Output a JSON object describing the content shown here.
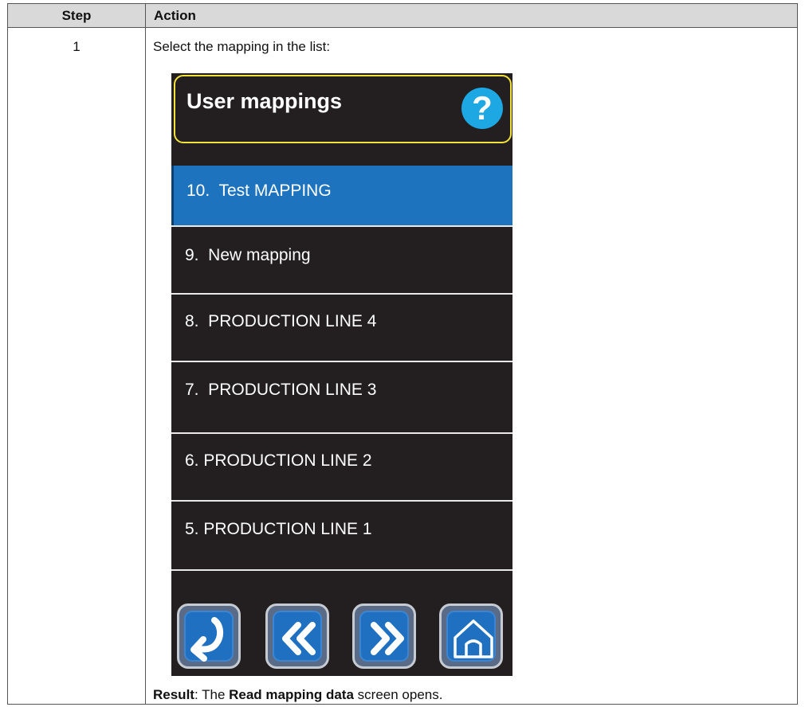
{
  "table": {
    "header": {
      "step": "Step",
      "action": "Action"
    },
    "row": {
      "step": "1",
      "instruction": "Select the mapping in the list:",
      "result": {
        "label": "Result",
        "prefix": ": The ",
        "emphasis": "Read mapping data",
        "suffix": " screen opens."
      }
    }
  },
  "device_screen": {
    "title": "User mappings",
    "help_symbol": "?",
    "items": [
      {
        "label": "10.  Test MAPPING",
        "selected": true
      },
      {
        "label": "9.  New mapping",
        "selected": false
      },
      {
        "label": "8.  PRODUCTION LINE 4",
        "selected": false
      },
      {
        "label": "7.  PRODUCTION LINE 3",
        "selected": false
      },
      {
        "label": "6. PRODUCTION LINE 2",
        "selected": false
      },
      {
        "label": "5. PRODUCTION LINE 1",
        "selected": false
      }
    ],
    "nav_buttons": [
      "return-icon",
      "page-previous-icon",
      "page-next-icon",
      "home-icon"
    ],
    "colors": {
      "screen_bg": "#231f20",
      "title_border": "#f2e23a",
      "help_icon": "#1da7e3",
      "selected_item": "#1e73be",
      "button_blue": "#1f70c0"
    }
  }
}
